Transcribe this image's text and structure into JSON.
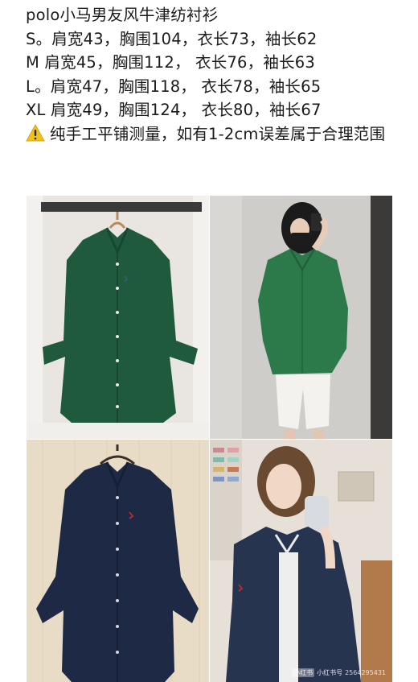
{
  "post": {
    "title": "polo小马男友风牛津纺衬衫",
    "sizes": [
      "S。肩宽43，胸围104，衣长73，袖长62",
      "M  肩宽45，胸围112， 衣长76，袖长63",
      "L。肩宽47，胸围118， 衣长78，袖长65",
      "XL 肩宽49，胸围124， 衣长80，袖长67"
    ],
    "note": "纯手工平铺测量，如有1-2cm误差属于合理范围",
    "warning_icon": "warning-icon"
  },
  "images": [
    {
      "name": "green-shirt-hanger-photo"
    },
    {
      "name": "green-shirt-model-photo"
    },
    {
      "name": "navy-shirt-hanger-photo"
    },
    {
      "name": "navy-shirt-model-photo"
    }
  ],
  "watermark": {
    "brand": "小红书",
    "label": "小红书号",
    "id": "2564295431"
  },
  "colors": {
    "green_shirt": "#1f5a3c",
    "navy_shirt": "#1e2a45",
    "warning": "#f2c21b"
  }
}
